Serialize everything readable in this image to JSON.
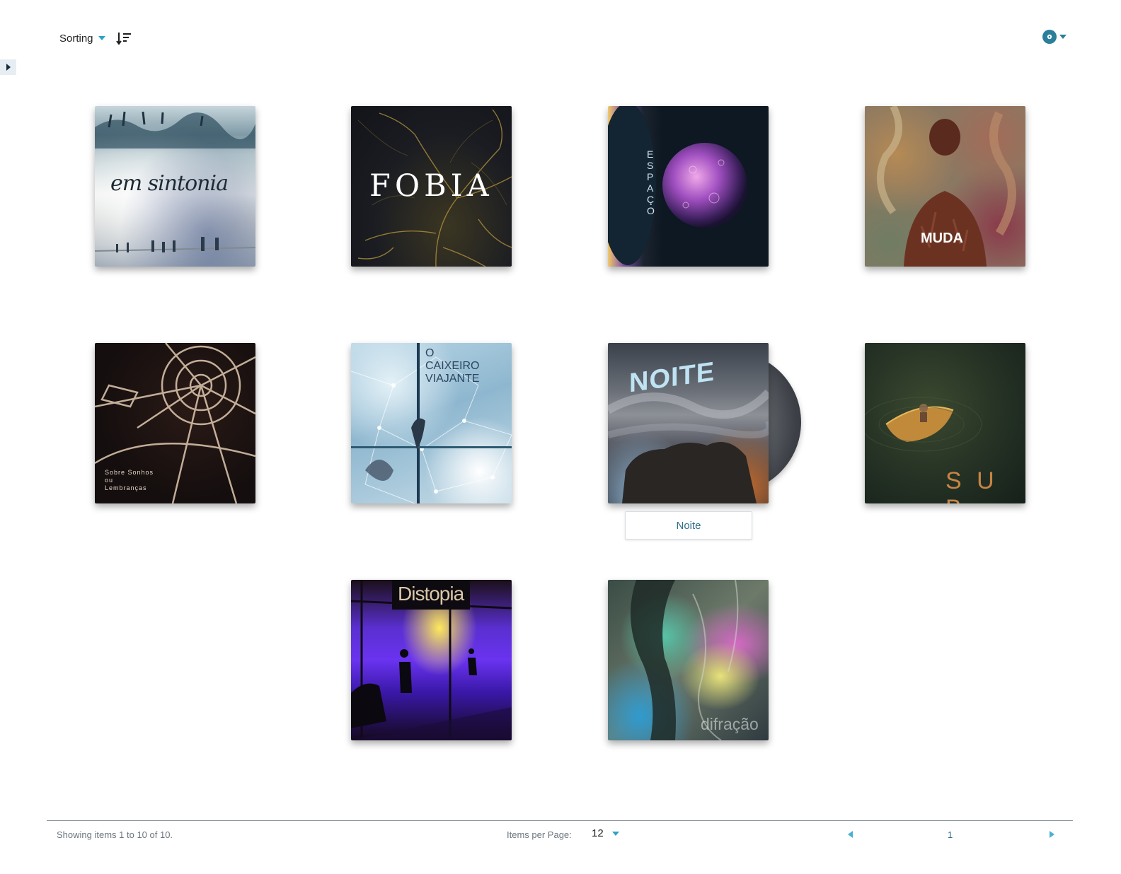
{
  "toolbar": {
    "sorting_label": "Sorting",
    "sort_order_icon": "sort-descending-icon",
    "settings_icon": "disc-icon"
  },
  "sidebar": {
    "toggle_icon": "caret-right-icon"
  },
  "colors": {
    "accent": "#2ea3c1",
    "link": "#2c6f88",
    "muted_text": "#6c757d"
  },
  "albums": [
    {
      "cover_text": "em sintonia"
    },
    {
      "cover_text": "FOBIA"
    },
    {
      "cover_text": "E S P A Ç O"
    },
    {
      "cover_text": "MUDA"
    },
    {
      "cover_text": "Sobre Sonhos ou Lembranças"
    },
    {
      "cover_text": "O CAIXEIRO VIAJANTE"
    },
    {
      "cover_text": "NOITE",
      "tooltip": "Noite"
    },
    {
      "cover_text": "S U B"
    },
    {
      "cover_text": "Distopia"
    },
    {
      "cover_text": "difração"
    }
  ],
  "footer": {
    "showing_text": "Showing items 1 to 10 of 10.",
    "items_per_page_label": "Items per Page:",
    "items_per_page_value": "12",
    "current_page": "1"
  }
}
